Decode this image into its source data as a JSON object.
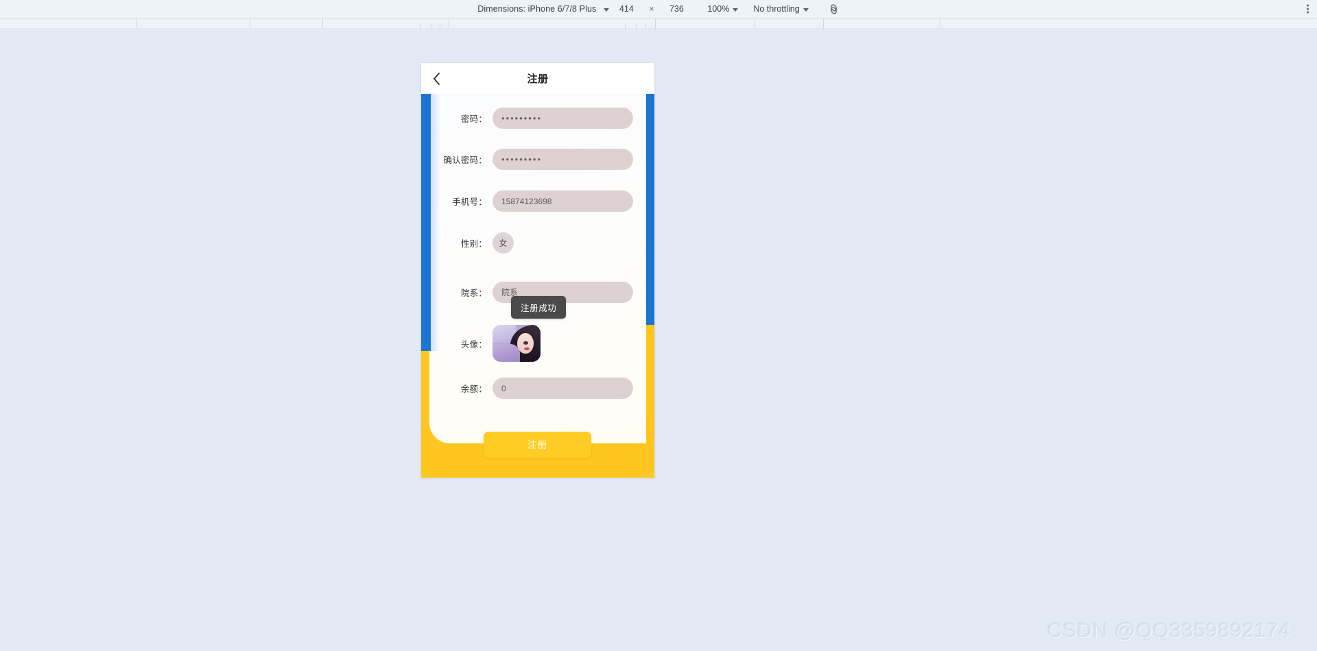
{
  "devtools": {
    "dimensions_label": "Dimensions: iPhone 6/7/8 Plus",
    "width_value": "414",
    "times_symbol": "×",
    "height_value": "736",
    "zoom_label": "100%",
    "throttling_label": "No throttling",
    "network_icon": "network-throttle-icon",
    "menu_icon": "kebab-menu-icon"
  },
  "app": {
    "nav": {
      "back_icon": "chevron-left-icon",
      "title": "注册"
    },
    "form": {
      "rows": [
        {
          "label": "密码：",
          "value": "•••••••••",
          "type": "password",
          "name": "password"
        },
        {
          "label": "确认密码：",
          "value": "•••••••••",
          "type": "password",
          "name": "confirm-password"
        },
        {
          "label": "手机号：",
          "value": "15874123698",
          "type": "text",
          "name": "phone"
        },
        {
          "label": "性别：",
          "value": "女",
          "type": "small",
          "name": "gender"
        },
        {
          "label": "院系：",
          "value": "院系",
          "type": "text",
          "name": "department"
        },
        {
          "label": "头像：",
          "value": "",
          "type": "avatar",
          "name": "avatar"
        },
        {
          "label": "余额：",
          "value": "0",
          "type": "text",
          "name": "balance"
        }
      ]
    },
    "toast": {
      "message": "注册成功"
    },
    "submit": {
      "label": "注册"
    },
    "colors": {
      "accent_yellow": "#ffc620",
      "accent_blue": "#1c75d1",
      "input_bg": "#ded1d1",
      "toast_bg": "#4a4a4a"
    }
  },
  "watermark": {
    "text": "CSDN @QQ3359892174"
  }
}
